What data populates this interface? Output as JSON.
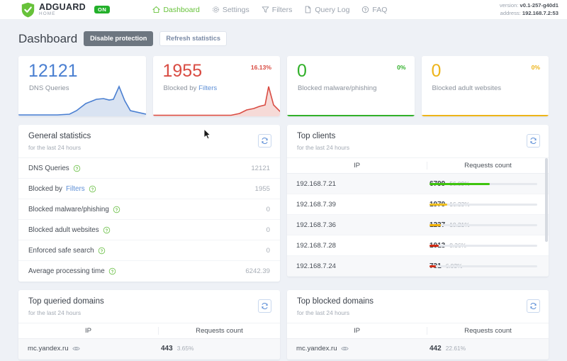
{
  "header": {
    "brand_name": "ADGUARD",
    "brand_sub": "HOME",
    "status_badge": "ON",
    "nav": [
      {
        "label": "Dashboard",
        "icon": "home-icon",
        "active": true
      },
      {
        "label": "Settings",
        "icon": "gear-icon",
        "active": false
      },
      {
        "label": "Filters",
        "icon": "funnel-icon",
        "active": false
      },
      {
        "label": "Query Log",
        "icon": "document-icon",
        "active": false
      },
      {
        "label": "FAQ",
        "icon": "question-circle-icon",
        "active": false
      }
    ],
    "version_label": "version:",
    "version_value": "v0.1-257-g40d1",
    "address_label": "address:",
    "address_value": "192.168.7.2:53"
  },
  "page": {
    "title": "Dashboard",
    "disable_protection_label": "Disable protection",
    "refresh_statistics_label": "Refresh statistics"
  },
  "counters": [
    {
      "value": "12121",
      "label": "DNS Queries",
      "link": "",
      "percent": "",
      "color": "#4a7fd1"
    },
    {
      "value": "1955",
      "label": "Blocked by",
      "link": "Filters",
      "percent": "16.13%",
      "color": "#d94c43"
    },
    {
      "value": "0",
      "label": "Blocked malware/phishing",
      "link": "",
      "percent": "0%",
      "color": "#31b02a"
    },
    {
      "value": "0",
      "label": "Blocked adult websites",
      "link": "",
      "percent": "0%",
      "color": "#edb419"
    }
  ],
  "general_statistics": {
    "title": "General statistics",
    "subtitle": "for the last 24 hours",
    "refresh_icon": "refresh-icon",
    "rows": [
      {
        "name": "DNS Queries",
        "link": "",
        "value": "12121"
      },
      {
        "name": "Blocked by",
        "link": "Filters",
        "value": "1955"
      },
      {
        "name": "Blocked malware/phishing",
        "link": "",
        "value": "0"
      },
      {
        "name": "Blocked adult websites",
        "link": "",
        "value": "0"
      },
      {
        "name": "Enforced safe search",
        "link": "",
        "value": "0"
      },
      {
        "name": "Average processing time",
        "link": "",
        "value": "6242.39"
      }
    ]
  },
  "top_clients": {
    "title": "Top clients",
    "subtitle": "for the last 24 hours",
    "refresh_icon": "refresh-icon",
    "columns": [
      "IP",
      "Requests count"
    ],
    "rows": [
      {
        "ip": "192.168.7.21",
        "count": "6799",
        "percent": "56.09%",
        "bar_pct": 56.09,
        "bar_color": "#3ec40e"
      },
      {
        "ip": "192.168.7.39",
        "count": "1979",
        "percent": "16.33%",
        "bar_pct": 16.33,
        "bar_color": "#f0c020"
      },
      {
        "ip": "192.168.7.36",
        "count": "1237",
        "percent": "10.21%",
        "bar_pct": 10.21,
        "bar_color": "#f0b000"
      },
      {
        "ip": "192.168.7.28",
        "count": "1013",
        "percent": "8.36%",
        "bar_pct": 8.36,
        "bar_color": "#d22b14"
      },
      {
        "ip": "192.168.7.24",
        "count": "731",
        "percent": "6.03%",
        "bar_pct": 6.03,
        "bar_color": "#d22b14"
      }
    ]
  },
  "top_queried_domains": {
    "title": "Top queried domains",
    "subtitle": "for the last 24 hours",
    "refresh_icon": "refresh-icon",
    "columns": [
      "IP",
      "Requests count"
    ],
    "rows": [
      {
        "domain": "mc.yandex.ru",
        "count": "443",
        "percent": "3.65%"
      }
    ]
  },
  "top_blocked_domains": {
    "title": "Top blocked domains",
    "subtitle": "for the last 24 hours",
    "refresh_icon": "refresh-icon",
    "columns": [
      "IP",
      "Requests count"
    ],
    "rows": [
      {
        "domain": "mc.yandex.ru",
        "count": "442",
        "percent": "22.61%"
      }
    ]
  },
  "chart_data": [
    {
      "type": "area",
      "title": "DNS Queries sparkline",
      "x": [
        0,
        1,
        2,
        3,
        4,
        5,
        6,
        7,
        8,
        9,
        10,
        11,
        12,
        13,
        14,
        15,
        16,
        17,
        18,
        19,
        20,
        21,
        22,
        23
      ],
      "values": [
        1,
        1,
        1,
        1,
        1,
        1,
        1,
        1,
        1,
        1,
        1,
        2,
        2,
        3,
        12,
        24,
        30,
        33,
        31,
        34,
        33,
        62,
        30,
        20
      ],
      "color": "#4a7fd1",
      "grid": false
    },
    {
      "type": "area",
      "title": "Blocked by Filters sparkline",
      "x": [
        0,
        1,
        2,
        3,
        4,
        5,
        6,
        7,
        8,
        9,
        10,
        11,
        12,
        13,
        14,
        15,
        16,
        17,
        18,
        19,
        20,
        21,
        22,
        23
      ],
      "values": [
        0,
        0,
        0,
        0,
        0,
        0,
        0,
        0,
        0,
        0,
        0,
        0,
        0,
        0,
        0,
        0,
        0,
        2,
        6,
        9,
        12,
        14,
        60,
        22
      ],
      "color": "#d94c43",
      "grid": false
    },
    {
      "type": "bar",
      "title": "Top clients requests count",
      "categories": [
        "192.168.7.21",
        "192.168.7.39",
        "192.168.7.36",
        "192.168.7.28",
        "192.168.7.24"
      ],
      "values": [
        6799,
        1979,
        1237,
        1013,
        731
      ],
      "percents": [
        56.09,
        16.33,
        10.21,
        8.36,
        6.03
      ],
      "xlabel": "IP",
      "ylabel": "Requests count"
    }
  ]
}
